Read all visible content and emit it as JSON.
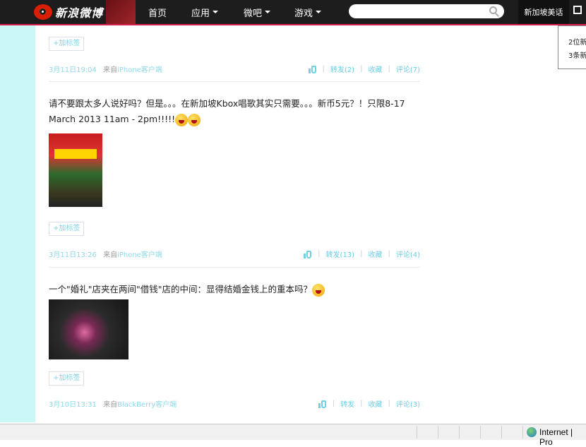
{
  "header": {
    "logo_text": "新浪微博",
    "nav": [
      {
        "label": "首页",
        "dropdown": false
      },
      {
        "label": "应用",
        "dropdown": true
      },
      {
        "label": "微吧",
        "dropdown": true
      },
      {
        "label": "游戏",
        "dropdown": true
      }
    ],
    "search_placeholder": "",
    "user_name": "新加坡美话"
  },
  "popup": {
    "lines": [
      "2位新",
      "3条新"
    ]
  },
  "posts": [
    {
      "text": "",
      "tag_button": "+加标签",
      "time": "3月11日19:04",
      "source_prefix": "来自",
      "source": "iPhone客户端",
      "repost": "转发(2)",
      "favorite": "收藏",
      "comment": "评论(7)"
    },
    {
      "text": "请不要跟太多人说好吗？但是。。。在新加坡Kbox唱歌其实只需要。。。新币5元？！只限8-17 March 2013 11am - 2pm!!!!!",
      "tag_button": "+加标签",
      "time": "3月11日13:26",
      "source_prefix": "来自",
      "source": "iPhone客户端",
      "repost": "转发(13)",
      "favorite": "收藏",
      "comment": "评论(4)"
    },
    {
      "text": "一个\"婚礼\"店夹在两间\"借钱\"店的中间：显得结婚金钱上的重本吗？",
      "tag_button": "+加标签",
      "time": "3月10日13:31",
      "source_prefix": "来自",
      "source": "BlackBerry客户端",
      "repost": "转发",
      "favorite": "收藏",
      "comment": "评论(3)"
    }
  ],
  "statusbar": {
    "zone": "Internet | Pro"
  }
}
